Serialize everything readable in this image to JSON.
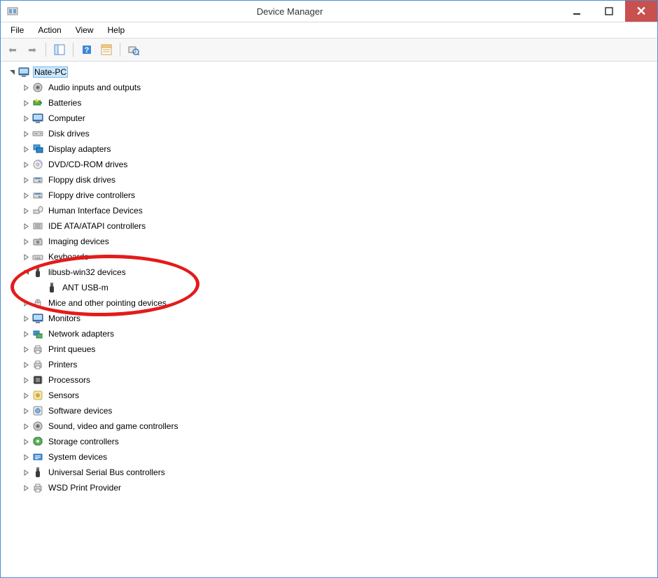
{
  "window": {
    "title": "Device Manager"
  },
  "menu": {
    "file": "File",
    "action": "Action",
    "view": "View",
    "help": "Help"
  },
  "root": {
    "label": "Nate-PC"
  },
  "categories": [
    {
      "id": "audio",
      "label": "Audio inputs and outputs",
      "icon": "speaker"
    },
    {
      "id": "batteries",
      "label": "Batteries",
      "icon": "battery"
    },
    {
      "id": "computer",
      "label": "Computer",
      "icon": "monitor"
    },
    {
      "id": "disk",
      "label": "Disk drives",
      "icon": "disk"
    },
    {
      "id": "display",
      "label": "Display adapters",
      "icon": "display"
    },
    {
      "id": "dvd",
      "label": "DVD/CD-ROM drives",
      "icon": "cd"
    },
    {
      "id": "floppy",
      "label": "Floppy disk drives",
      "icon": "floppy"
    },
    {
      "id": "floppyctl",
      "label": "Floppy drive controllers",
      "icon": "floppy"
    },
    {
      "id": "hid",
      "label": "Human Interface Devices",
      "icon": "hid"
    },
    {
      "id": "ide",
      "label": "IDE ATA/ATAPI controllers",
      "icon": "ide"
    },
    {
      "id": "imaging",
      "label": "Imaging devices",
      "icon": "camera"
    },
    {
      "id": "keyboards",
      "label": "Keyboards",
      "icon": "keyboard"
    },
    {
      "id": "libusb",
      "label": "libusb-win32 devices",
      "icon": "usb",
      "expanded": true,
      "children": [
        {
          "id": "antusbm",
          "label": "ANT USB-m",
          "icon": "usb"
        }
      ]
    },
    {
      "id": "mice",
      "label": "Mice and other pointing devices",
      "icon": "mouse"
    },
    {
      "id": "monitors",
      "label": "Monitors",
      "icon": "monitor"
    },
    {
      "id": "network",
      "label": "Network adapters",
      "icon": "network"
    },
    {
      "id": "printq",
      "label": "Print queues",
      "icon": "printer"
    },
    {
      "id": "printers",
      "label": "Printers",
      "icon": "printer"
    },
    {
      "id": "processors",
      "label": "Processors",
      "icon": "cpu"
    },
    {
      "id": "sensors",
      "label": "Sensors",
      "icon": "sensor"
    },
    {
      "id": "software",
      "label": "Software devices",
      "icon": "software"
    },
    {
      "id": "sound",
      "label": "Sound, video and game controllers",
      "icon": "speaker"
    },
    {
      "id": "storagectl",
      "label": "Storage controllers",
      "icon": "storage"
    },
    {
      "id": "system",
      "label": "System devices",
      "icon": "system"
    },
    {
      "id": "usb",
      "label": "Universal Serial Bus controllers",
      "icon": "usb"
    },
    {
      "id": "wsd",
      "label": "WSD Print Provider",
      "icon": "printer"
    }
  ]
}
